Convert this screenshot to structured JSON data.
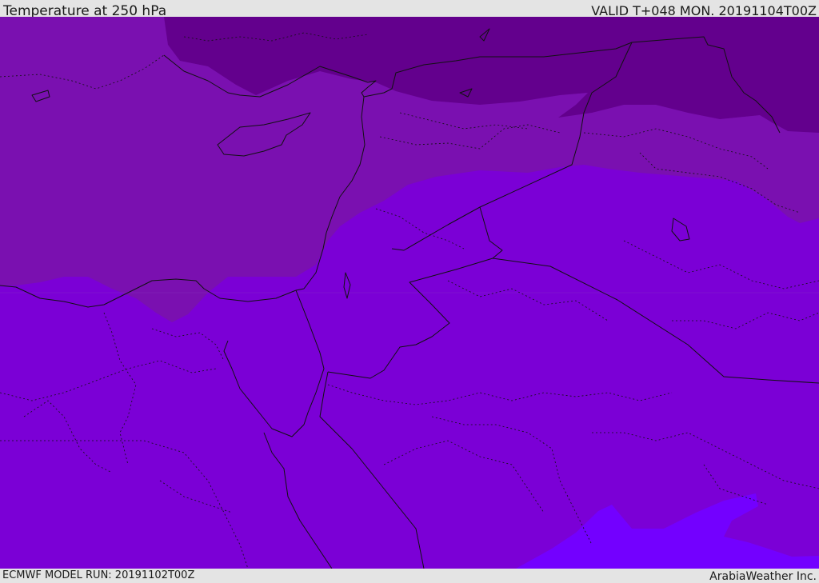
{
  "header": {
    "title": "Temperature at 250 hPa",
    "valid_time": "VALID T+048 MON. 20191104T00Z"
  },
  "footer": {
    "model_run": "ECMWF MODEL RUN: 20191102T00Z",
    "credit": "ArabiaWeather Inc."
  },
  "map": {
    "field": "temperature",
    "level": "250 hPa",
    "colors": {
      "coldest": "#63008d",
      "cold": "#7a10b0",
      "base": "#7b00d6",
      "warm": "#7300ff",
      "lines": "#111111"
    }
  }
}
